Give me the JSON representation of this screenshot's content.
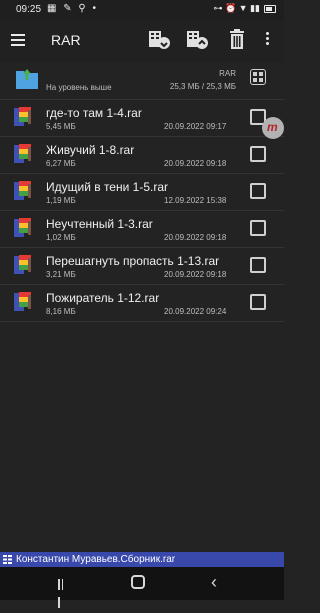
{
  "status_bar": {
    "time": "09:25",
    "left_icons": "▦ ✎ ⚲ •",
    "right_icons": "⊶ ⏰ ▼ ▮▮"
  },
  "toolbar": {
    "title": "RAR",
    "menu_icon": "hamburger-menu-icon",
    "extract_icon": "extract-archive-icon",
    "add_icon": "add-to-archive-icon",
    "delete_icon": "trash-icon",
    "more_icon": "more-vertical-icon"
  },
  "up_row": {
    "label": "На уровень выше",
    "archive_name": "RAR",
    "size": "25,3 МБ / 25,3 МБ"
  },
  "files": [
    {
      "name": "где-то там 1-4.rar",
      "size": "5,45 МБ",
      "date": "20.09.2022 09:17"
    },
    {
      "name": "Живучий 1-8.rar",
      "size": "6,27 МБ",
      "date": "20.09.2022 09:18"
    },
    {
      "name": "Идущий в тени 1-5.rar",
      "size": "1,19 МБ",
      "date": "12.09.2022 15:38"
    },
    {
      "name": "Неучтенный 1-3.rar",
      "size": "1,02 МБ",
      "date": "20.09.2022 09:18"
    },
    {
      "name": "Перешагнуть пропасть 1-13.rar",
      "size": "3,21 МБ",
      "date": "20.09.2022 09:18"
    },
    {
      "name": "Пожиратель 1-12.rar",
      "size": "8,16 МБ",
      "date": "20.09.2022 09:24"
    }
  ],
  "floating_badge": "m",
  "bottom_bar": {
    "text": "Константин Муравьев.Сборник.rar"
  },
  "colors": {
    "background": "#232323",
    "accent_bar": "#3949ab",
    "folder": "#4fa3e0"
  }
}
